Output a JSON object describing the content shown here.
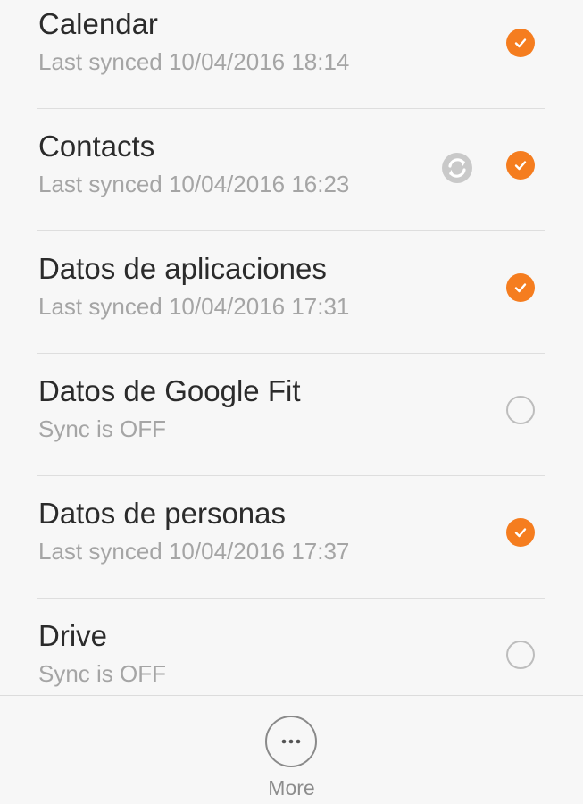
{
  "sync_items": [
    {
      "title": "Calendar",
      "status": "Last synced 10/04/2016 18:14",
      "checked": true,
      "syncing": false
    },
    {
      "title": "Contacts",
      "status": "Last synced 10/04/2016 16:23",
      "checked": true,
      "syncing": true
    },
    {
      "title": "Datos de aplicaciones",
      "status": "Last synced 10/04/2016 17:31",
      "checked": true,
      "syncing": false
    },
    {
      "title": "Datos de Google Fit",
      "status": "Sync is OFF",
      "checked": false,
      "syncing": false
    },
    {
      "title": "Datos de personas",
      "status": "Last synced 10/04/2016 17:37",
      "checked": true,
      "syncing": false
    },
    {
      "title": "Drive",
      "status": "Sync is OFF",
      "checked": false,
      "syncing": false
    }
  ],
  "footer": {
    "more_label": "More",
    "more_icon": "more-dots-icon"
  },
  "colors": {
    "accent": "#f57d1f",
    "title_text": "#2b2b2b",
    "subtitle_text": "#a5a5a5"
  },
  "icons": {
    "checked": "check-icon",
    "syncing": "sync-refresh-icon"
  }
}
